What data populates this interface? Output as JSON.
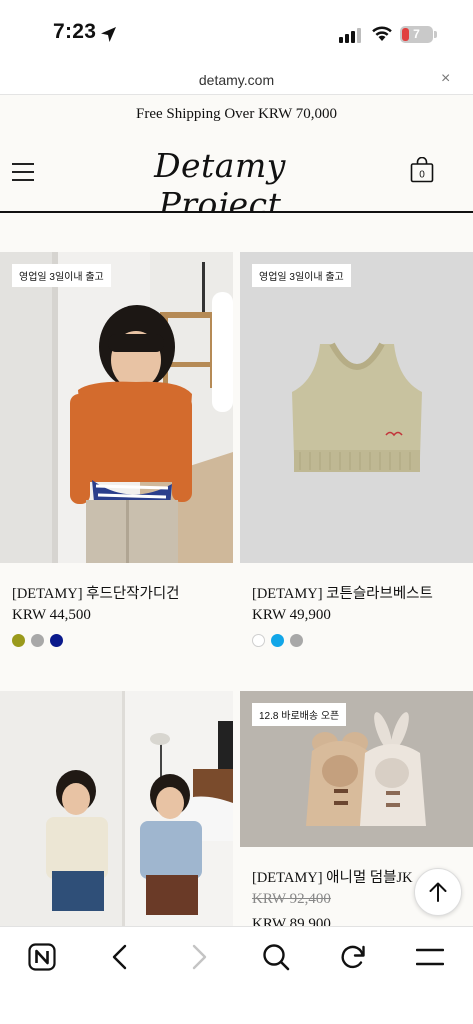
{
  "status_bar": {
    "time": "7:23",
    "battery": "7",
    "icons": [
      "location-arrow-icon",
      "cellular-signal-icon",
      "wifi-icon",
      "battery-icon"
    ]
  },
  "browser": {
    "url": "detamy.com",
    "close_glyph": "×",
    "toolbar": [
      "naver-home-icon",
      "back-icon",
      "forward-icon",
      "search-icon",
      "reload-icon",
      "menu-icon"
    ]
  },
  "header": {
    "promo": "Free Shipping Over KRW 70,000",
    "logo": "Detamy Project",
    "icons": [
      "hamburger-menu-icon",
      "shopping-bag-icon"
    ],
    "bag_count": "0"
  },
  "products": [
    {
      "badge": "영업일 3일이내 출고",
      "name": "[DETAMY] 후드단작가디건",
      "price": "KRW 44,500",
      "swatches": [
        "#9a9a1c",
        "#a8a8a8",
        "#0b1a8c"
      ]
    },
    {
      "badge": "영업일 3일이내 출고",
      "name": "[DETAMY] 코튼슬라브베스트",
      "price": "KRW 49,900",
      "swatches": [
        "#ffffff",
        "#12a6e8",
        "#a8a8a8"
      ]
    },
    {
      "badge": "",
      "name": "",
      "price": ""
    },
    {
      "badge": "12.8 바로배송 오픈",
      "name": "[DETAMY] 애니멀 덤블JK",
      "old_price": "KRW 92,400",
      "price": "KRW 89,900"
    }
  ],
  "colors": {
    "accent": "#111111",
    "page_bg": "#fbfaf7"
  }
}
